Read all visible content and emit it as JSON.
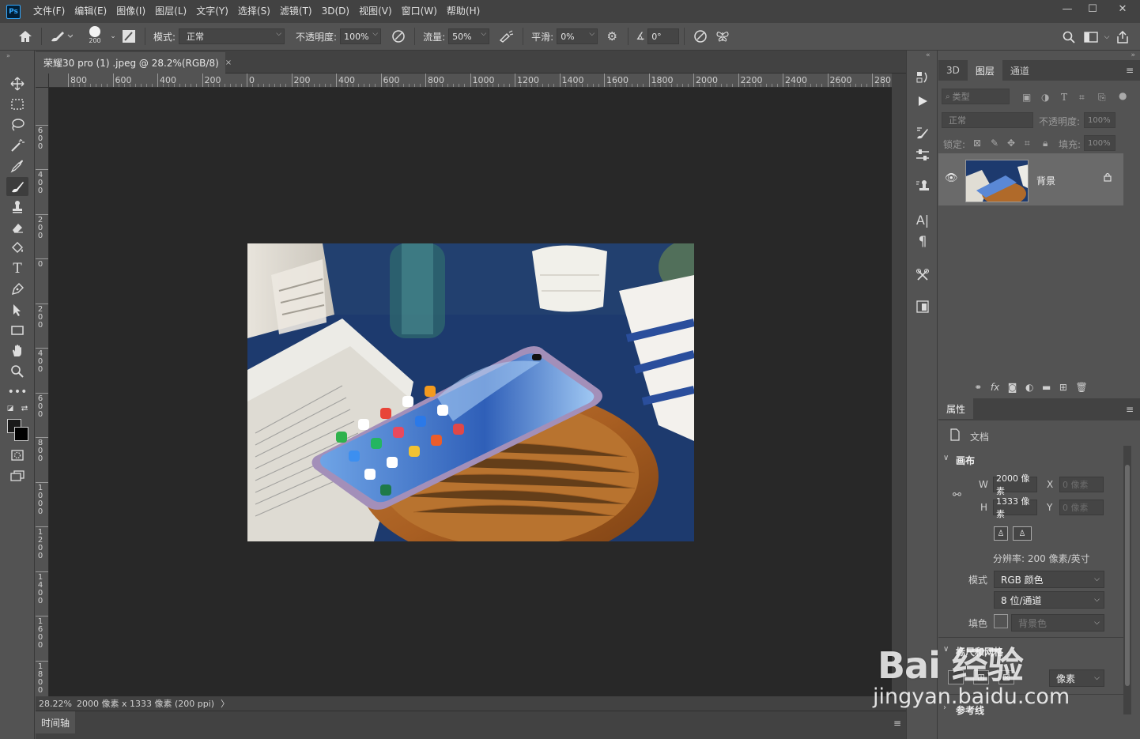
{
  "app": {
    "logo": "Ps",
    "menu": [
      "文件(F)",
      "编辑(E)",
      "图像(I)",
      "图层(L)",
      "文字(Y)",
      "选择(S)",
      "滤镜(T)",
      "3D(D)",
      "视图(V)",
      "窗口(W)",
      "帮助(H)"
    ],
    "window_controls": [
      "—",
      "☐",
      "✕"
    ]
  },
  "options": {
    "brush_size": "200",
    "mode_label": "模式:",
    "mode_value": "正常",
    "opacity_label": "不透明度:",
    "opacity_value": "100%",
    "flow_label": "流量:",
    "flow_value": "50%",
    "smoothing_label": "平滑:",
    "smoothing_value": "0%",
    "angle_value": "0°"
  },
  "document": {
    "tab_title": "荣耀30 pro  (1)  .jpeg @ 28.2%(RGB/8)",
    "tab_close": "×",
    "ruler_h_labels": [
      "800",
      "600",
      "400",
      "200",
      "0",
      "200",
      "400",
      "600",
      "800",
      "1000",
      "1200",
      "1400",
      "1600",
      "1800",
      "2000",
      "2200",
      "2400",
      "2600",
      "280"
    ],
    "ruler_v_labels": [
      "0",
      "600",
      "400",
      "200",
      "0",
      "200",
      "400",
      "600",
      "800",
      "1000",
      "1200",
      "1400",
      "1600",
      "1800"
    ],
    "zoom": "28.22%",
    "dimensions": "2000 像素 x 1333 像素 (200 ppi)",
    "status_arrow": "〉",
    "timeline_tab": "时间轴"
  },
  "layers_panel": {
    "tabs": [
      "3D",
      "图层",
      "通道"
    ],
    "active_tab": "图层",
    "filter_placeholder": "类型",
    "blend_mode": "正常",
    "opacity_label": "不透明度:",
    "opacity_value": "100%",
    "lock_label": "锁定:",
    "fill_label": "填充:",
    "fill_value": "100%",
    "layers": [
      {
        "name": "背景",
        "visible": true,
        "locked": true
      }
    ],
    "footer_icons": [
      "link-icon",
      "fx-icon",
      "mask-icon",
      "adjustment-icon",
      "folder-icon",
      "new-layer-icon",
      "trash-icon"
    ]
  },
  "properties_panel": {
    "tab": "属性",
    "doc_label": "文档",
    "canvas_section": "画布",
    "w_label": "W",
    "w_value": "2000 像素",
    "h_label": "H",
    "h_value": "1333 像素",
    "x_label": "X",
    "x_value": "0 像素",
    "y_label": "Y",
    "y_value": "0 像素",
    "resolution": "分辨率: 200 像素/英寸",
    "mode_label": "模式",
    "mode_value": "RGB 颜色",
    "bit_depth": "8 位/通道",
    "fill_label": "填色",
    "fill_value": "背景色",
    "rulers_section": "标尺和网格",
    "units_value": "像素",
    "guides_section": "参考线"
  },
  "watermark": {
    "main": "Bai 经验",
    "sub": "jingyan.baidu.com"
  },
  "colors": {
    "ui_dark": "#424242",
    "ui_mid": "#535353",
    "canvas_bg": "#282828",
    "accent": "#31a8ff"
  }
}
